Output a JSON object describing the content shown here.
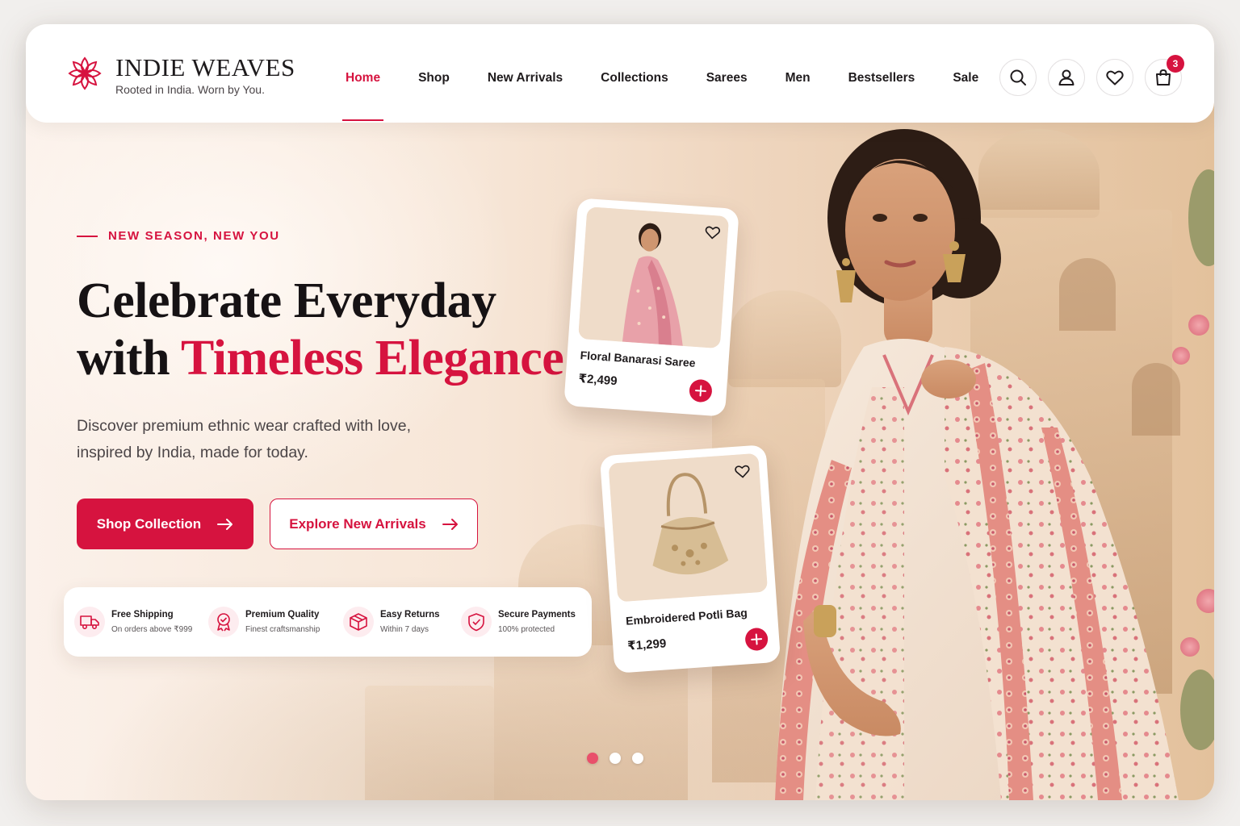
{
  "brand": {
    "name": "INDIE WEAVES",
    "tagline": "Rooted in India. Worn by You.",
    "accent_color": "#d6133f"
  },
  "nav": {
    "items": [
      {
        "label": "Home",
        "active": true
      },
      {
        "label": "Shop",
        "active": false
      },
      {
        "label": "New Arrivals",
        "active": false
      },
      {
        "label": "Collections",
        "active": false
      },
      {
        "label": "Sarees",
        "active": false
      },
      {
        "label": "Men",
        "active": false
      },
      {
        "label": "Bestsellers",
        "active": false
      },
      {
        "label": "Sale",
        "active": false
      }
    ]
  },
  "header_icons": {
    "search": "search-icon",
    "account": "user-icon",
    "wishlist": "heart-icon",
    "cart": "shopping-bag-icon",
    "cart_count": "3"
  },
  "hero": {
    "eyebrow": "NEW SEASON, NEW YOU",
    "headline_line1": "Celebrate Everyday",
    "headline_with": "with",
    "headline_accent": "Timeless Elegance",
    "subtext": "Discover premium ethnic wear crafted with love, inspired by India, made for today.",
    "primary_cta": "Shop Collection",
    "secondary_cta": "Explore New Arrivals"
  },
  "features": [
    {
      "title": "Free Shipping",
      "desc": "On orders above ₹999",
      "icon": "truck-icon"
    },
    {
      "title": "Premium Quality",
      "desc": "Finest craftsmanship",
      "icon": "award-icon"
    },
    {
      "title": "Easy Returns",
      "desc": "Within 7 days",
      "icon": "box-icon"
    },
    {
      "title": "Secure Payments",
      "desc": "100% protected",
      "icon": "shield-icon"
    }
  ],
  "products": [
    {
      "name": "Floral Banarasi Saree",
      "price": "₹2,499"
    },
    {
      "name": "Embroidered Potli Bag",
      "price": "₹1,299"
    }
  ],
  "carousel": {
    "count": 3,
    "active_index": 0
  }
}
